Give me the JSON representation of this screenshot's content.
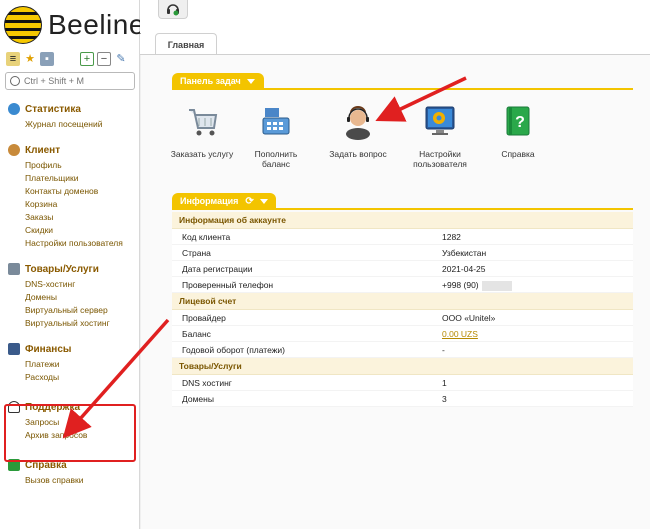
{
  "brand": {
    "name": "Beeline"
  },
  "search": {
    "placeholder": "Ctrl + Shift + M"
  },
  "sidebar": {
    "groups": [
      {
        "title": "Статистика",
        "icon": "globe-icon",
        "items": [
          "Журнал посещений"
        ]
      },
      {
        "title": "Клиент",
        "icon": "user-icon",
        "items": [
          "Профиль",
          "Плательщики",
          "Контакты доменов",
          "Корзина",
          "Заказы",
          "Скидки",
          "Настройки пользователя"
        ]
      },
      {
        "title": "Товары/Услуги",
        "icon": "cart-icon",
        "items": [
          "DNS-хостинг",
          "Домены",
          "Виртуальный сервер",
          "Виртуальный хостинг"
        ]
      },
      {
        "title": "Финансы",
        "icon": "finance-icon",
        "items": [
          "Платежи",
          "Расходы"
        ]
      },
      {
        "title": "Поддержка",
        "icon": "headset-icon",
        "items": [
          "Запросы",
          "Архив запросов"
        ]
      },
      {
        "title": "Справка",
        "icon": "help-book-icon",
        "items": [
          "Вызов справки"
        ]
      }
    ]
  },
  "tabs": {
    "main": "Главная"
  },
  "taskbar": {
    "title": "Панель задач",
    "tasks": [
      {
        "label": "Заказать услугу",
        "icon": "cart-icon"
      },
      {
        "label": "Пополнить баланс",
        "icon": "cash-register-icon"
      },
      {
        "label": "Задать вопрос",
        "icon": "support-agent-icon"
      },
      {
        "label": "Настройки пользователя",
        "icon": "settings-monitor-icon"
      },
      {
        "label": "Справка",
        "icon": "help-book-icon"
      }
    ]
  },
  "info": {
    "title": "Информация",
    "sections": [
      {
        "title": "Информация об аккаунте",
        "rows": [
          {
            "k": "Код клиента",
            "v": "1282"
          },
          {
            "k": "Страна",
            "v": "Узбекистан"
          },
          {
            "k": "Дата регистрации",
            "v": "2021-04-25"
          },
          {
            "k": "Проверенный телефон",
            "v": "+998 (90)"
          }
        ]
      },
      {
        "title": "Лицевой счет",
        "rows": [
          {
            "k": "Провайдер",
            "v": "ООО «Unitel»"
          },
          {
            "k": "Баланс",
            "v": "0.00 UZS"
          },
          {
            "k": "Годовой оборот (платежи)",
            "v": "-"
          }
        ]
      },
      {
        "title": "Товары/Услуги",
        "rows": [
          {
            "k": "DNS хостинг",
            "v": "1"
          },
          {
            "k": "Домены",
            "v": "3"
          }
        ]
      }
    ]
  },
  "colors": {
    "accent": "#f3c400",
    "link": "#7a5600",
    "annotation": "#e02020"
  }
}
